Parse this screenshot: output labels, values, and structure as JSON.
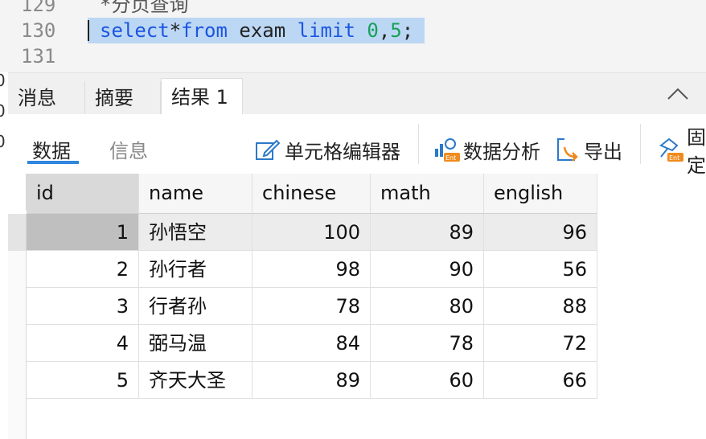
{
  "editor": {
    "lines": [
      {
        "num": "129",
        "text": "*分页查询"
      },
      {
        "num": "130",
        "tokens": [
          {
            "t": "select",
            "c": "kw"
          },
          {
            "t": "*",
            "c": "plain"
          },
          {
            "t": "from",
            "c": "kw"
          },
          {
            "t": " exam ",
            "c": "plain"
          },
          {
            "t": "limit",
            "c": "kw"
          },
          {
            "t": " ",
            "c": "plain"
          },
          {
            "t": "0",
            "c": "num"
          },
          {
            "t": ",",
            "c": "plain"
          },
          {
            "t": "5",
            "c": "num"
          },
          {
            "t": ";",
            "c": "plain"
          }
        ]
      },
      {
        "num": "131",
        "text": ""
      }
    ],
    "edge_digits": [
      "0",
      "0",
      "0"
    ]
  },
  "tabs": [
    "消息",
    "摘要",
    "结果 1"
  ],
  "subtabs": [
    "数据",
    "信息"
  ],
  "toolbar": {
    "cell_editor": "单元格编辑器",
    "data_analysis": "数据分析",
    "export": "导出",
    "pin": "固定"
  },
  "grid": {
    "columns": [
      "id",
      "name",
      "chinese",
      "math",
      "english"
    ],
    "rows": [
      [
        "1",
        "孙悟空",
        "100",
        "89",
        "96"
      ],
      [
        "2",
        "孙行者",
        "98",
        "90",
        "56"
      ],
      [
        "3",
        "行者孙",
        "78",
        "80",
        "88"
      ],
      [
        "4",
        "弼马温",
        "84",
        "78",
        "72"
      ],
      [
        "5",
        "齐天大圣",
        "89",
        "60",
        "66"
      ]
    ],
    "selected_row": 0
  },
  "colors": {
    "keyword": "#1b55e2",
    "number": "#17a05a",
    "selection": "#bcd7f4",
    "accent": "#2e86de"
  }
}
